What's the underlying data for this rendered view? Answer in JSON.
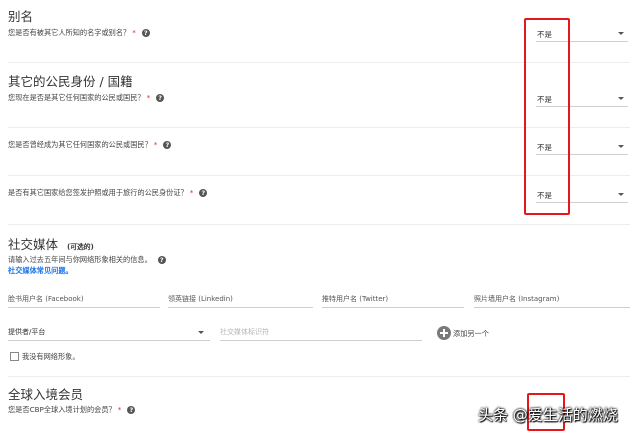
{
  "aliases": {
    "title": "别名",
    "question": "您是否有被其它人所知的名字或别名？",
    "value": "不是"
  },
  "nationality": {
    "title": "其它的公民身份 / 国籍",
    "q1": {
      "question": "您现在是否是其它任何国家的公民或国民？",
      "value": "不是"
    },
    "q2": {
      "question": "您是否曾经成为其它任何国家的公民或国民？",
      "value": "不是"
    },
    "q3": {
      "question": "是否有其它国家给您签发护照或用于旅行的公民身份证？",
      "value": "不是"
    }
  },
  "social": {
    "title": "社交媒体",
    "optional": "(可选的)",
    "instruction": "请输入过去五年间与你网络形象相关的信息。",
    "faq_link": "社交媒体常见问题。",
    "fields": [
      "脸书用户名 (Facebook)",
      "领英链接 (Linkedin)",
      "推特用户名 (Twitter)",
      "照片墙用户名 (Instagram)"
    ],
    "provider_label": "提供者/平台",
    "identifier_placeholder": "社交媒体标识符",
    "add_another": "添加另一个",
    "no_presence": "我没有网络形象。"
  },
  "global_entry": {
    "title": "全球入境会员",
    "question": "您是否CBP全球入境计划的会员？"
  },
  "watermark": "头条 @爱生活的燃烧",
  "colors": {
    "highlight": "#e5171b",
    "required": "#d93025",
    "link": "#1a73e8"
  }
}
